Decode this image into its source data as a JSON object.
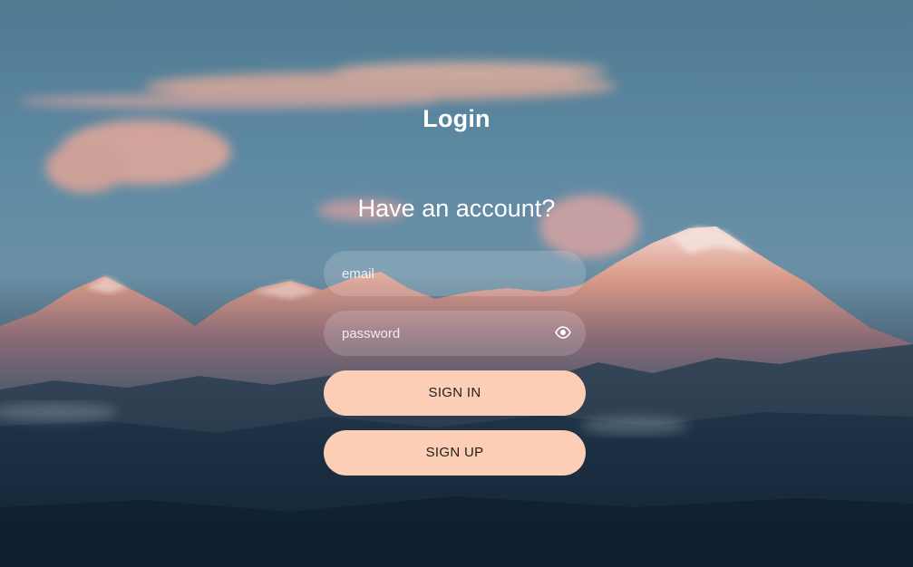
{
  "login": {
    "title": "Login",
    "subtitle": "Have an account?",
    "email_placeholder": "email",
    "password_placeholder": "password",
    "sign_in_label": "SIGN IN",
    "sign_up_label": "SIGN UP"
  },
  "icons": {
    "password_toggle": "eye-icon"
  },
  "colors": {
    "button_fill": "#fcceb6",
    "text": "#ffffff",
    "button_text": "#1f1f1f"
  }
}
